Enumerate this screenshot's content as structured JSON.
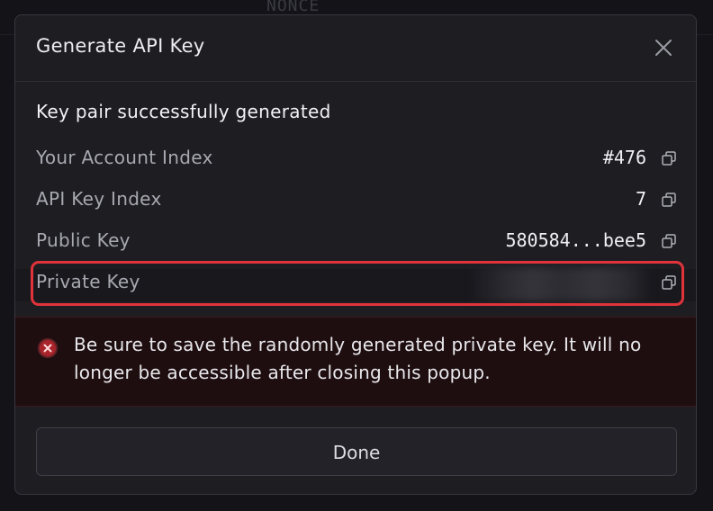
{
  "background": {
    "header_text": "NONCE"
  },
  "modal": {
    "title": "Generate API Key",
    "close_icon": "close-icon",
    "section_title": "Key pair successfully generated",
    "rows": [
      {
        "label": "Your Account Index",
        "value": "#476",
        "icon": "copy-icon"
      },
      {
        "label": "API Key Index",
        "value": "7",
        "icon": "copy-icon"
      },
      {
        "label": "Public Key",
        "value": "580584...bee5",
        "icon": "copy-icon"
      },
      {
        "label": "Private Key",
        "value": "",
        "icon": "copy-icon",
        "masked": true
      }
    ],
    "warning": {
      "icon": "error-icon",
      "text": "Be sure to save the randomly generated private key. It will no longer be accessible after closing this popup."
    },
    "done_label": "Done"
  },
  "colors": {
    "highlight": "#e0333a",
    "warning_bg": "#1f0e10",
    "error_icon": "#e5484d"
  }
}
